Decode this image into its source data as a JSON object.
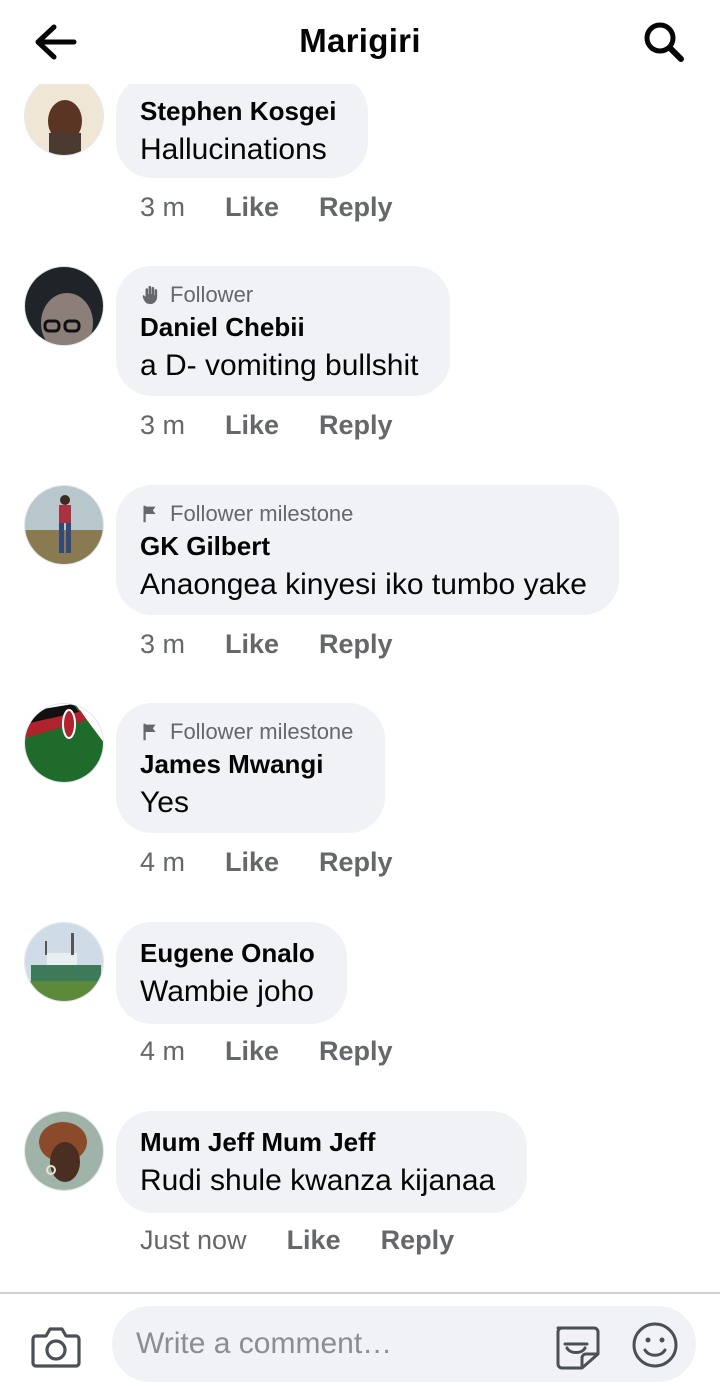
{
  "header": {
    "title": "Marigiri",
    "back_icon": "arrow-left-icon",
    "search_icon": "search-icon"
  },
  "comments": [
    {
      "author": "Stephen Kosgei",
      "badge": "",
      "text": "Hallucinations",
      "time": "3 m",
      "like": "Like",
      "reply": "Reply"
    },
    {
      "author": "Daniel Chebii",
      "badge": "Follower",
      "badge_icon": "waving-hand-icon",
      "text": "a D-  vomiting bullshit",
      "time": "3 m",
      "like": "Like",
      "reply": "Reply"
    },
    {
      "author": "GK Gilbert",
      "badge": "Follower milestone",
      "badge_icon": "flag-icon",
      "text": "Anaongea kinyesi iko tumbo yake",
      "time": "3 m",
      "like": "Like",
      "reply": "Reply"
    },
    {
      "author": "James Mwangi",
      "badge": "Follower milestone",
      "badge_icon": "flag-icon",
      "text": "Yes",
      "time": "4 m",
      "like": "Like",
      "reply": "Reply"
    },
    {
      "author": "Eugene Onalo",
      "badge": "",
      "text": "Wambie joho",
      "time": "4 m",
      "like": "Like",
      "reply": "Reply"
    },
    {
      "author": "Mum Jeff Mum Jeff",
      "badge": "",
      "text": "Rudi shule kwanza kijanaa",
      "time": "Just now",
      "like": "Like",
      "reply": "Reply"
    }
  ],
  "composer": {
    "placeholder": "Write a comment…",
    "camera_icon": "camera-icon",
    "sticker_icon": "sticker-icon",
    "emoji_icon": "emoji-icon"
  },
  "colors": {
    "bubble": "#f0f2f5",
    "secondary_text": "#65676b",
    "primary_text": "#050505"
  }
}
